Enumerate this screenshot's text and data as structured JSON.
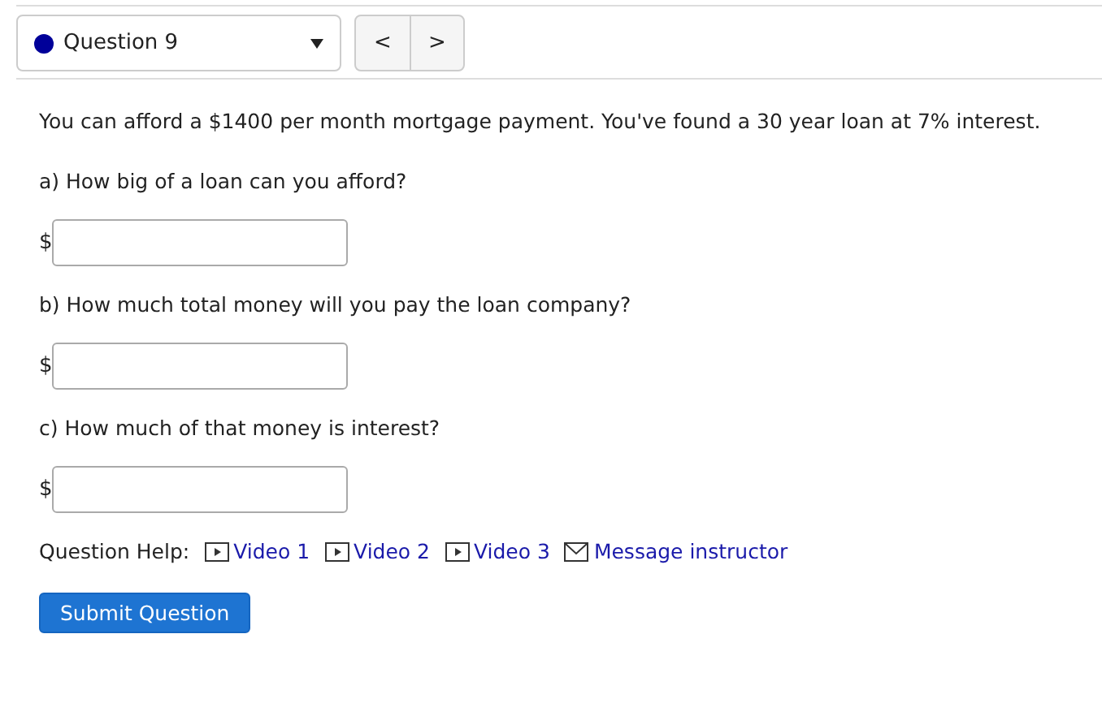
{
  "question_selector": {
    "label": "Question 9",
    "attempted": true
  },
  "nav": {
    "prev": "<",
    "next": ">"
  },
  "intro": "You can afford a $1400 per month mortgage payment. You've found a 30 year loan at 7% interest.",
  "parts": [
    {
      "prompt": "a) How big of a loan can you afford?",
      "prefix": "$"
    },
    {
      "prompt": "b) How much total money will you pay the loan company?",
      "prefix": "$"
    },
    {
      "prompt": "c) How much of that money is interest?",
      "prefix": "$"
    }
  ],
  "help": {
    "label": "Question Help:",
    "links": [
      {
        "kind": "video",
        "text": "Video 1"
      },
      {
        "kind": "video",
        "text": "Video 2"
      },
      {
        "kind": "video",
        "text": "Video 3"
      },
      {
        "kind": "message",
        "text": "Message instructor"
      }
    ]
  },
  "submit": "Submit Question"
}
